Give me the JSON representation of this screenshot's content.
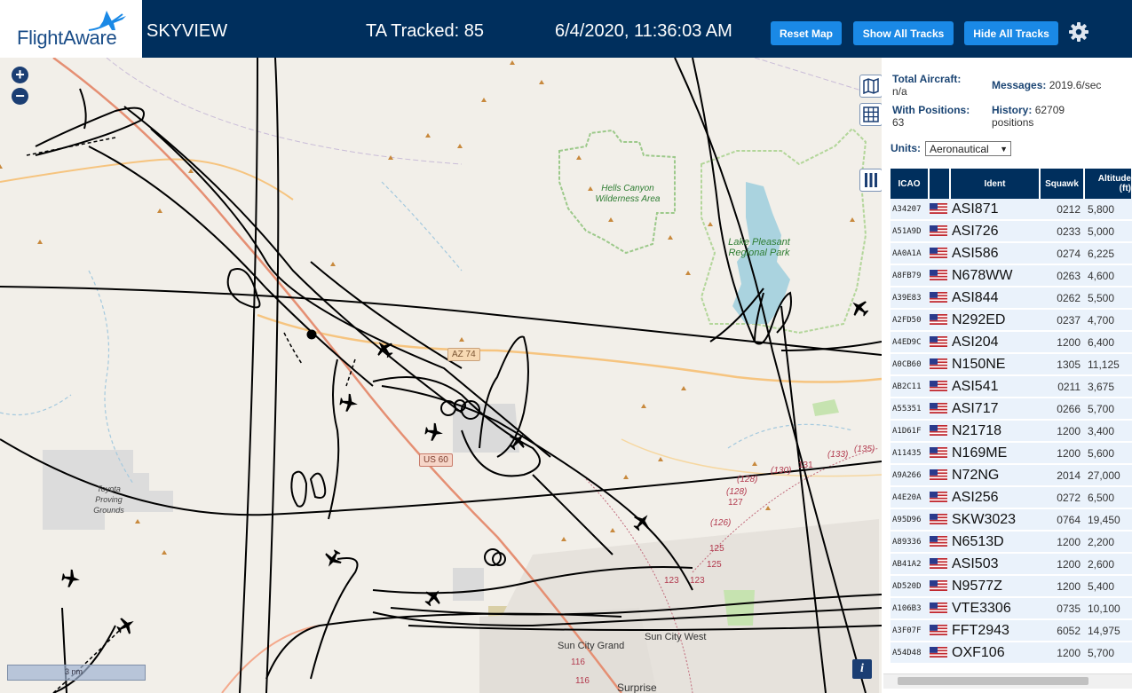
{
  "header": {
    "logo": "FlightAware",
    "title": "SKYVIEW",
    "tracked": "TA Tracked: 85",
    "datetime": "6/4/2020, 11:36:03 AM",
    "buttons": {
      "reset": "Reset Map",
      "show": "Show All Tracks",
      "hide": "Hide All Tracks"
    }
  },
  "map": {
    "labels": {
      "hells": "Hells Canyon Wilderness Area",
      "lake": "Lake Pleasant Regional Park",
      "toyota": "Toyota Proving Grounds",
      "az74": "AZ 74",
      "us60": "US 60",
      "suncitygrand": "Sun City Grand",
      "suncitywest": "Sun City West",
      "surprise": "Surprise",
      "r116a": "116",
      "r116b": "116",
      "r125a": "125",
      "r125b": "125",
      "r126": "(126)",
      "r127": "127",
      "r128a": "(128)",
      "r128b": "(128)",
      "r131": "131",
      "r133": "(133)",
      "r135": "(135)",
      "r130": "(130)",
      "r123": "123",
      "r123b": "123"
    },
    "scale": "3 nm",
    "info": "i"
  },
  "sidebar": {
    "total_label": "Total Aircraft:",
    "total_value": "n/a",
    "messages_label": "Messages:",
    "messages_value": "2019.6/sec",
    "positions_label": "With Positions:",
    "positions_value": "63",
    "history_label": "History:",
    "history_value": "62709 positions",
    "units_label": "Units:",
    "units_value": "Aeronautical",
    "columns": {
      "icao": "ICAO",
      "ident": "Ident",
      "squawk": "Squawk",
      "altitude": "Altitude (ft)"
    },
    "rows": [
      {
        "icao": "A34207",
        "ident": "ASI871",
        "squawk": "0212",
        "alt": "5,800"
      },
      {
        "icao": "A51A9D",
        "ident": "ASI726",
        "squawk": "0233",
        "alt": "5,000"
      },
      {
        "icao": "AA0A1A",
        "ident": "ASI586",
        "squawk": "0274",
        "alt": "6,225"
      },
      {
        "icao": "A8FB79",
        "ident": "N678WW",
        "squawk": "0263",
        "alt": "4,600"
      },
      {
        "icao": "A39E83",
        "ident": "ASI844",
        "squawk": "0262",
        "alt": "5,500"
      },
      {
        "icao": "A2FD50",
        "ident": "N292ED",
        "squawk": "0237",
        "alt": "4,700"
      },
      {
        "icao": "A4ED9C",
        "ident": "ASI204",
        "squawk": "1200",
        "alt": "6,400"
      },
      {
        "icao": "A0CB60",
        "ident": "N150NE",
        "squawk": "1305",
        "alt": "11,125"
      },
      {
        "icao": "AB2C11",
        "ident": "ASI541",
        "squawk": "0211",
        "alt": "3,675"
      },
      {
        "icao": "A55351",
        "ident": "ASI717",
        "squawk": "0266",
        "alt": "5,700"
      },
      {
        "icao": "A1D61F",
        "ident": "N21718",
        "squawk": "1200",
        "alt": "3,400"
      },
      {
        "icao": "A11435",
        "ident": "N169ME",
        "squawk": "1200",
        "alt": "5,600"
      },
      {
        "icao": "A9A266",
        "ident": "N72NG",
        "squawk": "2014",
        "alt": "27,000"
      },
      {
        "icao": "A4E20A",
        "ident": "ASI256",
        "squawk": "0272",
        "alt": "6,500"
      },
      {
        "icao": "A95D96",
        "ident": "SKW3023",
        "squawk": "0764",
        "alt": "19,450"
      },
      {
        "icao": "A89336",
        "ident": "N6513D",
        "squawk": "1200",
        "alt": "2,200"
      },
      {
        "icao": "AB41A2",
        "ident": "ASI503",
        "squawk": "1200",
        "alt": "2,600"
      },
      {
        "icao": "AD520D",
        "ident": "N9577Z",
        "squawk": "1200",
        "alt": "5,400"
      },
      {
        "icao": "A106B3",
        "ident": "VTE3306",
        "squawk": "0735",
        "alt": "10,100"
      },
      {
        "icao": "A3F07F",
        "ident": "FFT2943",
        "squawk": "6052",
        "alt": "14,975"
      },
      {
        "icao": "A54D48",
        "ident": "OXF106",
        "squawk": "1200",
        "alt": "5,700"
      }
    ]
  },
  "colors": {
    "header": "#002f5d",
    "button": "#1a89e6",
    "row": "#eaf2fb",
    "track": "#000000"
  }
}
